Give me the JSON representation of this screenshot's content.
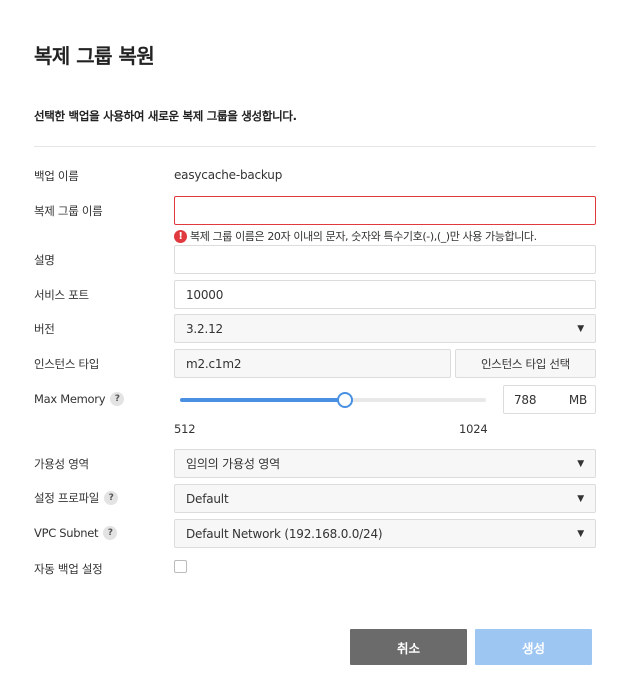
{
  "dialog": {
    "title": "복제 그룹 복원",
    "subtitle": "선택한 백업을 사용하여 새로운 복제 그룹을 생성합니다."
  },
  "form": {
    "backup_name": {
      "label": "백업 이름",
      "value": "easycache-backup"
    },
    "group_name": {
      "label": "복제 그룹 이름",
      "value": "",
      "error_icon": "!",
      "error": "복제 그룹 이름은 20자 이내의 문자, 숫자와 특수기호(-),(_)만 사용 가능합니다."
    },
    "description": {
      "label": "설명",
      "value": ""
    },
    "service_port": {
      "label": "서비스 포트",
      "value": "10000"
    },
    "version": {
      "label": "버전",
      "value": "3.2.12"
    },
    "instance_type": {
      "label": "인스턴스 타입",
      "value": "m2.c1m2",
      "button": "인스턴스 타입 선택"
    },
    "max_memory": {
      "label": "Max Memory",
      "help": "?",
      "value": "788",
      "unit": "MB",
      "min": "512",
      "max": "1024",
      "min_value": 512,
      "max_value": 1024,
      "current": 788
    },
    "availability_zone": {
      "label": "가용성 영역",
      "value": "임의의 가용성 영역"
    },
    "config_profile": {
      "label": "설정 프로파일",
      "help": "?",
      "value": "Default"
    },
    "vpc_subnet": {
      "label": "VPC Subnet",
      "help": "?",
      "value": "Default Network (192.168.0.0/24)"
    },
    "auto_backup": {
      "label": "자동 백업 설정",
      "checked": false
    }
  },
  "icons": {
    "caret": "▼"
  },
  "colors": {
    "accent": "#4a90e2",
    "error": "#e0393e",
    "cancel": "#6b6b6b",
    "create_disabled": "#9ec6f3"
  },
  "footer": {
    "cancel": "취소",
    "create": "생성"
  }
}
